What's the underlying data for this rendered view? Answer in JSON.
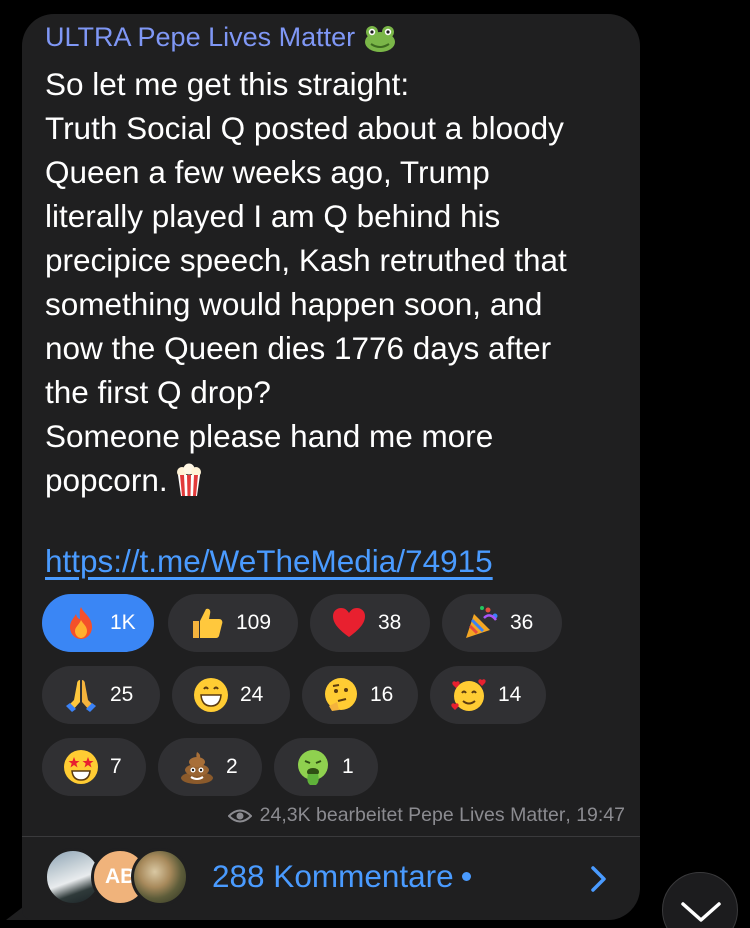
{
  "message": {
    "sender": "ULTRA Pepe Lives Matter",
    "sender_icon": "frog-icon",
    "lines": [
      "So let me get this straight:",
      "Truth Social Q posted about a bloody",
      "Queen a few weeks ago, Trump",
      "literally played I am Q behind his",
      "precipice speech, Kash retruthed that",
      "something would happen soon, and",
      "now the Queen dies 1776 days after",
      "the first Q drop?",
      "Someone please hand me more",
      "popcorn."
    ],
    "link": "https://t.me/WeTheMedia/74915",
    "views": "24,3K",
    "edited_label": "bearbeitet",
    "author_signature": "Pepe Lives Matter",
    "time": "19:47"
  },
  "reactions": [
    {
      "emoji": "fire",
      "count": "1K",
      "active": true
    },
    {
      "emoji": "thumbs-up",
      "count": "109",
      "active": false
    },
    {
      "emoji": "red-heart",
      "count": "38",
      "active": false
    },
    {
      "emoji": "party-popper",
      "count": "36",
      "active": false
    },
    {
      "emoji": "folded-hands",
      "count": "25",
      "active": false
    },
    {
      "emoji": "grinning-face",
      "count": "24",
      "active": false
    },
    {
      "emoji": "thinking-face",
      "count": "16",
      "active": false
    },
    {
      "emoji": "smiling-face-with-hearts",
      "count": "14",
      "active": false
    },
    {
      "emoji": "star-struck",
      "count": "7",
      "active": false
    },
    {
      "emoji": "pile-of-poo",
      "count": "2",
      "active": false
    },
    {
      "emoji": "face-vomiting",
      "count": "1",
      "active": false
    }
  ],
  "comments": {
    "label": "288 Kommentare",
    "avatar_initials": "AB",
    "has_unread": true
  },
  "colors": {
    "background": "#000000",
    "bubble": "#1f1f20",
    "sender": "#7f97f5",
    "link": "#4a9bff",
    "chip": "#303033",
    "chip_active": "#3a86f5",
    "meta": "#8b8b90"
  }
}
